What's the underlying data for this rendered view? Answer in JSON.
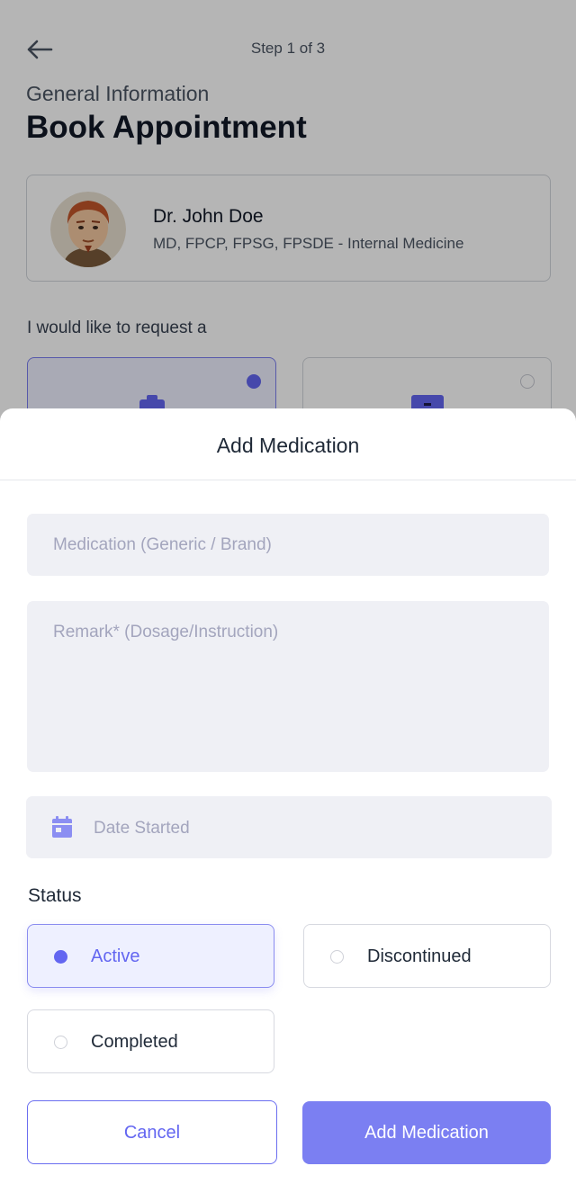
{
  "header": {
    "step_text": "Step 1 of 3",
    "subtitle": "General Information",
    "title": "Book Appointment"
  },
  "doctor": {
    "name": "Dr. John Doe",
    "specialty": "MD, FPCP, FPSG, FPSDE - Internal Medicine"
  },
  "request": {
    "label": "I would like to request a",
    "options": [
      {
        "icon": "clipboard-icon",
        "selected": true
      },
      {
        "icon": "id-card-icon",
        "selected": false
      }
    ]
  },
  "sheet": {
    "title": "Add Medication",
    "medication_placeholder": "Medication (Generic / Brand)",
    "remark_placeholder": "Remark* (Dosage/Instruction)",
    "date_placeholder": "Date Started",
    "status_label": "Status",
    "status_options": [
      {
        "label": "Active",
        "selected": true
      },
      {
        "label": "Discontinued",
        "selected": false
      },
      {
        "label": "Completed",
        "selected": false
      }
    ],
    "cancel_label": "Cancel",
    "add_label": "Add Medication"
  },
  "colors": {
    "accent": "#6366f1",
    "button_primary": "#7b7ff2",
    "field_bg": "#eff0f5",
    "placeholder": "#a3a5bd"
  }
}
